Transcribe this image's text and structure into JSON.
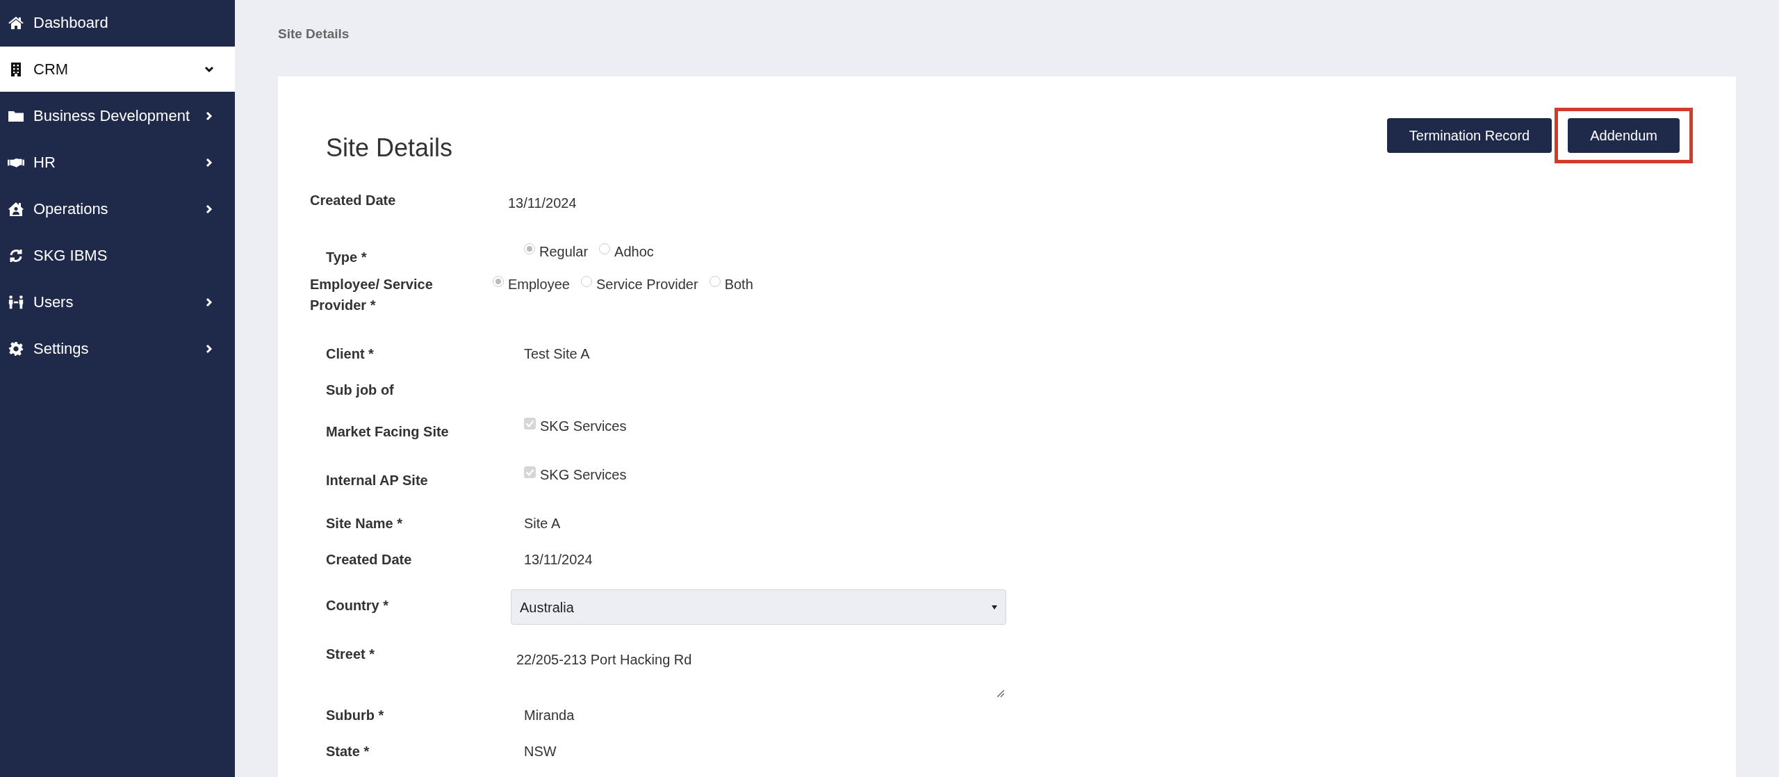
{
  "sidebar": {
    "items": [
      {
        "label": "Dashboard",
        "selected": false
      },
      {
        "label": "CRM",
        "selected": true,
        "expanded": true
      },
      {
        "label": "Business Development",
        "selected": false,
        "expanded": false
      },
      {
        "label": "HR",
        "selected": false,
        "expanded": false
      },
      {
        "label": "Operations",
        "selected": false,
        "expanded": false
      },
      {
        "label": "SKG IBMS",
        "selected": false
      },
      {
        "label": "Users",
        "selected": false,
        "expanded": false
      },
      {
        "label": "Settings",
        "selected": false,
        "expanded": false
      }
    ]
  },
  "breadcrumb": "Site Details",
  "card": {
    "title": "Site Details",
    "buttons": [
      {
        "label": "Termination Record",
        "highlighted": false
      },
      {
        "label": "Addendum",
        "highlighted": true
      }
    ],
    "fields": [
      {
        "kind": "text",
        "label": "Created Date",
        "indented": false,
        "value": "13/11/2024"
      },
      {
        "kind": "radio",
        "label": "Type *",
        "indented": true,
        "disabled": true,
        "options": [
          {
            "label": "Regular",
            "selected": true
          },
          {
            "label": "Adhoc",
            "selected": false
          }
        ]
      },
      {
        "kind": "radio",
        "label": "Employee/ Service Provider *",
        "indented": false,
        "disabled": true,
        "options": [
          {
            "label": "Employee",
            "selected": true
          },
          {
            "label": "Service Provider",
            "selected": false
          },
          {
            "label": "Both",
            "selected": false
          }
        ]
      },
      {
        "kind": "text",
        "label": "Client *",
        "indented": true,
        "value": "Test Site A"
      },
      {
        "kind": "text",
        "label": "Sub job of",
        "indented": true
      },
      {
        "kind": "checkbox",
        "label": "Market Facing Site",
        "indented": true,
        "disabled": true,
        "checked": true,
        "value": "SKG Services"
      },
      {
        "kind": "checkbox",
        "label": "Internal AP Site",
        "indented": true,
        "disabled": true,
        "checked": true,
        "value": "SKG Services"
      },
      {
        "kind": "text",
        "label": "Site Name *",
        "indented": true,
        "value": "Site A"
      },
      {
        "kind": "text",
        "label": "Created Date",
        "indented": true,
        "value": "13/11/2024"
      },
      {
        "kind": "select",
        "label": "Country *",
        "indented": true,
        "value": "Australia"
      },
      {
        "kind": "textarea",
        "label": "Street *",
        "indented": true,
        "value": "22/205-213 Port Hacking Rd"
      },
      {
        "kind": "text",
        "label": "Suburb *",
        "indented": true,
        "value": "Miranda"
      },
      {
        "kind": "text",
        "label": "State *",
        "indented": true,
        "value": "NSW"
      }
    ]
  }
}
